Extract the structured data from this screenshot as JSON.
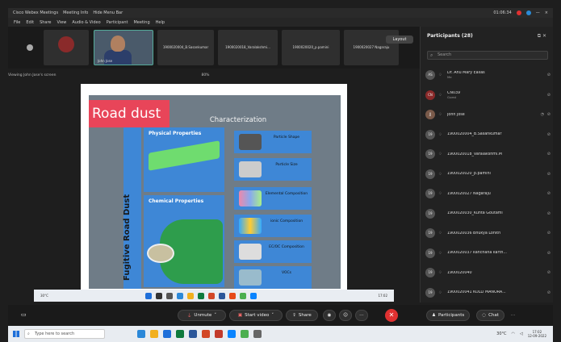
{
  "titlebar": {
    "app": "Cisco Webex Meetings",
    "meeting_info": "Meeting Info",
    "hide_menu": "Hide Menu Bar",
    "time": "01:06:34",
    "minimize": "—",
    "close": "×"
  },
  "menubar": [
    "File",
    "Edit",
    "Share",
    "View",
    "Audio & Video",
    "Participant",
    "Meeting",
    "Help"
  ],
  "thumbnails": [
    {
      "name": "John Jose"
    },
    {
      "name": "1900020004_B.Sasankumar"
    },
    {
      "name": "1900020018_Varalakshmi..."
    },
    {
      "name": "1900020020_p.pamini"
    },
    {
      "name": "1900020027 Nagaraju"
    }
  ],
  "layout_button": "Layout",
  "viewbar": {
    "viewing": "Viewing John Jose's screen",
    "zoom": "80%"
  },
  "slide": {
    "title": "Road dust",
    "subtitle": "Characterization",
    "side_label": "Fugitive Road Dust",
    "physical": "Physical Properties",
    "chemical": "Chemical Properties",
    "boxes": [
      "Particle Shape",
      "Particle Size",
      "Elemental Composition",
      "ionic Composition",
      "EC/OC Composition",
      "VOCs"
    ]
  },
  "participants_panel": {
    "header": "Participants (28)",
    "search_placeholder": "Search",
    "list": [
      {
        "initials": "AS",
        "name": "Dr. Anu Mary Ealias",
        "role": "Me"
      },
      {
        "initials": "CN",
        "name": "CN039",
        "role": "Guest"
      },
      {
        "initials": "JJ",
        "name": "John Jose",
        "role": ""
      },
      {
        "initials": "19",
        "name": "1900020004_B.Sasankumar",
        "role": ""
      },
      {
        "initials": "19",
        "name": "1900020018_Varalakshmi.M",
        "role": ""
      },
      {
        "initials": "19",
        "name": "1900020020_p.pamini",
        "role": ""
      },
      {
        "initials": "19",
        "name": "1900020027 Nagaraju",
        "role": ""
      },
      {
        "initials": "19",
        "name": "1900020030_Kunta Goutami",
        "role": ""
      },
      {
        "initials": "19",
        "name": "1900020036 Bhukya Lohith",
        "role": ""
      },
      {
        "initials": "19",
        "name": "1900020037 kanchana karth...",
        "role": ""
      },
      {
        "initials": "19",
        "name": "1900020040",
        "role": ""
      },
      {
        "initials": "19",
        "name": "1900020041 KOLLI MANORA...",
        "role": ""
      }
    ]
  },
  "controls": {
    "unmute": "Unmute",
    "start_video": "Start video",
    "share": "Share",
    "participants": "Participants",
    "chat": "Chat"
  },
  "taskbar": {
    "search_placeholder": "Type here to search",
    "temp": "30°C",
    "time": "17:02",
    "date": "12-09-2022"
  },
  "mini_taskbar": {
    "weather": "30°C",
    "time": "17:02"
  },
  "colors": {
    "accent": "#3e87d6",
    "slide_title_bg": "#e84559",
    "end_call": "#e03131"
  }
}
